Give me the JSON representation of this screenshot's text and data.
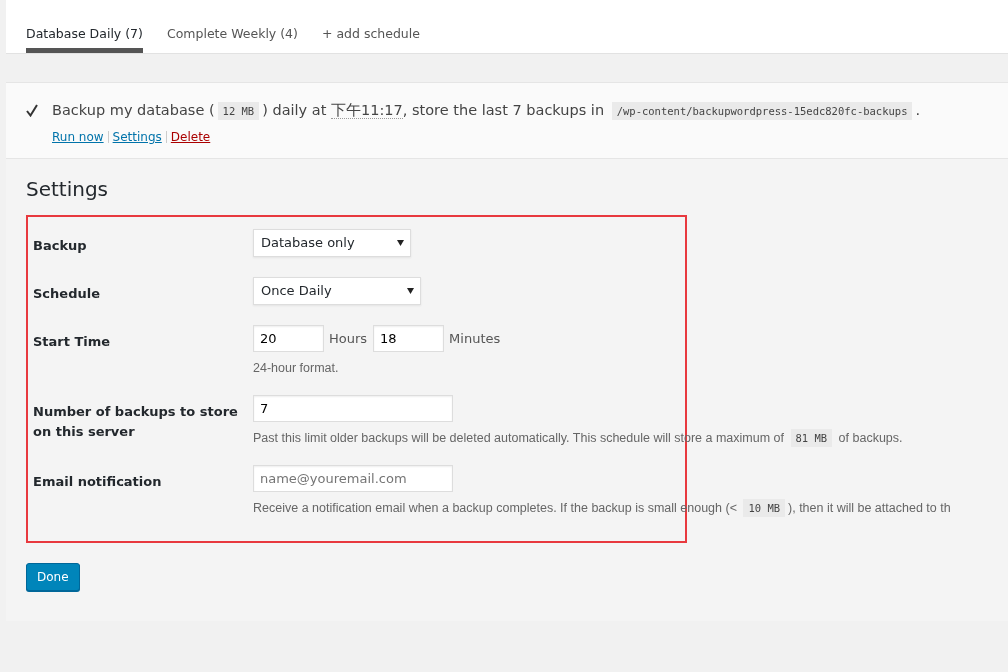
{
  "tabs": [
    {
      "label": "Database Daily (7)",
      "selected": true
    },
    {
      "label": "Complete Weekly (4)",
      "selected": false
    },
    {
      "label": "+ add schedule",
      "selected": false
    }
  ],
  "schedule": {
    "done": true,
    "summary": [
      {
        "kind": "text",
        "text": "Backup my database ("
      },
      {
        "kind": "code",
        "text": "12 MB"
      },
      {
        "kind": "text",
        "text": ") daily at "
      },
      {
        "kind": "time",
        "text": "下午11:17"
      },
      {
        "kind": "text",
        "text": ", store the last 7 backups in "
      },
      {
        "kind": "code",
        "text": "/wp-content/backupwordpress-15edc820fc-backups"
      },
      {
        "kind": "text",
        "text": "."
      }
    ],
    "actions": [
      {
        "label": "Run now",
        "kind": "normal"
      },
      {
        "label": "Settings",
        "kind": "normal"
      },
      {
        "label": "Delete",
        "kind": "delete"
      }
    ]
  },
  "settings": {
    "title": "Settings",
    "rows": [
      {
        "label": "Backup",
        "kind": "select",
        "value": "Database only"
      },
      {
        "label": "Schedule",
        "kind": "select",
        "value": "Once Daily"
      },
      {
        "label": "Start Time",
        "kind": "time",
        "hours": "20",
        "hours_label": "Hours",
        "minutes": "18",
        "minutes_label": "Minutes",
        "help": [
          {
            "kind": "text",
            "text": "24-hour format."
          }
        ]
      },
      {
        "label": "Number of backups to store on this server",
        "kind": "text",
        "value": "7",
        "help": [
          {
            "kind": "text",
            "text": "Past this limit older backups will be deleted automatically. This schedule will store a maximum of "
          },
          {
            "kind": "code",
            "text": "81 MB"
          },
          {
            "kind": "text",
            "text": " of backups."
          }
        ]
      },
      {
        "label": "Email notification",
        "kind": "email",
        "placeholder": "name@youremail.com",
        "help": [
          {
            "kind": "text",
            "text": "Receive a notification email when a backup completes. If the backup is small enough (< "
          },
          {
            "kind": "code",
            "text": "10 MB"
          },
          {
            "kind": "text",
            "text": "), then it will be attached to th"
          }
        ]
      }
    ],
    "done_button": "Done"
  }
}
